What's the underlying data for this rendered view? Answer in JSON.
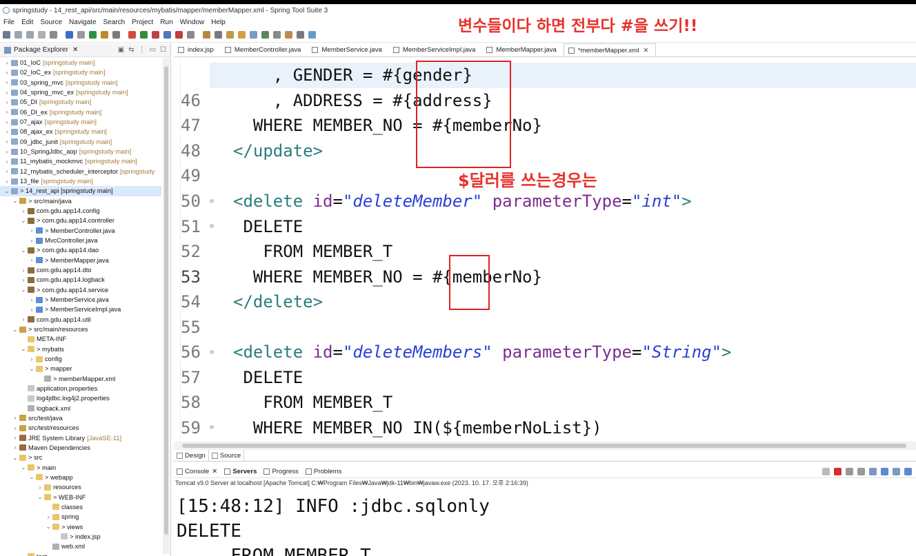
{
  "window": {
    "title": "springstudy - 14_rest_api/src/main/resources/mybatis/mapper/memberMapper.xml - Spring Tool Suite 3"
  },
  "menu": [
    "File",
    "Edit",
    "Source",
    "Navigate",
    "Search",
    "Project",
    "Run",
    "Window",
    "Help"
  ],
  "annotations": {
    "top": "변수들이다 하면 전부다 #을 쓰기!!",
    "middle": "$달러를 쓰는경우는"
  },
  "explorer": {
    "title": "Package Explorer",
    "items": [
      {
        "label": "01_IoC",
        "dec": "[springstudy main]",
        "indent": 0,
        "icon": "proj",
        "tw": "›"
      },
      {
        "label": "02_IoC_ex",
        "dec": "[springstudy main]",
        "indent": 0,
        "icon": "proj",
        "tw": "›"
      },
      {
        "label": "03_spring_mvc",
        "dec": "[springstudy main]",
        "indent": 0,
        "icon": "proj",
        "tw": "›"
      },
      {
        "label": "04_spring_mvc_ex",
        "dec": "[springstudy main]",
        "indent": 0,
        "icon": "proj",
        "tw": "›"
      },
      {
        "label": "05_DI",
        "dec": "[springstudy main]",
        "indent": 0,
        "icon": "proj",
        "tw": "›"
      },
      {
        "label": "06_DI_ex",
        "dec": "[springstudy main]",
        "indent": 0,
        "icon": "proj",
        "tw": "›"
      },
      {
        "label": "07_ajax",
        "dec": "[springstudy main]",
        "indent": 0,
        "icon": "proj",
        "tw": "›"
      },
      {
        "label": "08_ajax_ex",
        "dec": "[springstudy main]",
        "indent": 0,
        "icon": "proj",
        "tw": "›"
      },
      {
        "label": "09_jdbc_junit",
        "dec": "[springstudy main]",
        "indent": 0,
        "icon": "proj",
        "tw": "›"
      },
      {
        "label": "10_SpringJdbc_aop",
        "dec": "[springstudy main]",
        "indent": 0,
        "icon": "proj",
        "tw": "›"
      },
      {
        "label": "11_mybatis_mockmvc",
        "dec": "[springstudy main]",
        "indent": 0,
        "icon": "proj",
        "tw": "›"
      },
      {
        "label": "12_mybatis_scheduler_interceptor",
        "dec": "[springstudy",
        "indent": 0,
        "icon": "proj",
        "tw": "›"
      },
      {
        "label": "13_file",
        "dec": "[springstudy main]",
        "indent": 0,
        "icon": "proj",
        "tw": "›"
      },
      {
        "label": "> 14_rest_api [springstudy main]",
        "dec": "",
        "indent": 0,
        "icon": "proj",
        "tw": "⌄",
        "selected": true
      },
      {
        "label": "> src/main/java",
        "dec": "",
        "indent": 1,
        "icon": "srcf",
        "tw": "⌄"
      },
      {
        "label": "com.gdu.app14.config",
        "dec": "",
        "indent": 2,
        "icon": "pkg",
        "tw": "›"
      },
      {
        "label": "> com.gdu.app14.controller",
        "dec": "",
        "indent": 2,
        "icon": "pkg",
        "tw": "⌄"
      },
      {
        "label": "> MemberController.java",
        "dec": "",
        "indent": 3,
        "icon": "java",
        "tw": "›"
      },
      {
        "label": "MvcController.java",
        "dec": "",
        "indent": 3,
        "icon": "java",
        "tw": "›"
      },
      {
        "label": "> com.gdu.app14.dao",
        "dec": "",
        "indent": 2,
        "icon": "pkg",
        "tw": "⌄"
      },
      {
        "label": "> MemberMapper.java",
        "dec": "",
        "indent": 3,
        "icon": "java",
        "tw": "›"
      },
      {
        "label": "com.gdu.app14.dto",
        "dec": "",
        "indent": 2,
        "icon": "pkg",
        "tw": "›"
      },
      {
        "label": "com.gdu.app14.logback",
        "dec": "",
        "indent": 2,
        "icon": "pkg",
        "tw": "›"
      },
      {
        "label": "> com.gdu.app14.service",
        "dec": "",
        "indent": 2,
        "icon": "pkg",
        "tw": "⌄"
      },
      {
        "label": "> MemberService.java",
        "dec": "",
        "indent": 3,
        "icon": "java",
        "tw": "›"
      },
      {
        "label": "> MemberServiceImpl.java",
        "dec": "",
        "indent": 3,
        "icon": "java",
        "tw": "›"
      },
      {
        "label": "com.gdu.app14.util",
        "dec": "",
        "indent": 2,
        "icon": "pkg",
        "tw": "›"
      },
      {
        "label": "> src/main/resources",
        "dec": "",
        "indent": 1,
        "icon": "srcf",
        "tw": "⌄"
      },
      {
        "label": "META-INF",
        "dec": "",
        "indent": 2,
        "icon": "folder",
        "tw": ""
      },
      {
        "label": "> mybatis",
        "dec": "",
        "indent": 2,
        "icon": "folder",
        "tw": "⌄"
      },
      {
        "label": "config",
        "dec": "",
        "indent": 3,
        "icon": "folder",
        "tw": "›"
      },
      {
        "label": "> mapper",
        "dec": "",
        "indent": 3,
        "icon": "folder",
        "tw": "⌄"
      },
      {
        "label": "> memberMapper.xml",
        "dec": "",
        "indent": 4,
        "icon": "xml",
        "tw": ""
      },
      {
        "label": "application.properties",
        "dec": "",
        "indent": 2,
        "icon": "file",
        "tw": ""
      },
      {
        "label": "log4jdbc.log4j2.properties",
        "dec": "",
        "indent": 2,
        "icon": "file",
        "tw": ""
      },
      {
        "label": "logback.xml",
        "dec": "",
        "indent": 2,
        "icon": "xml",
        "tw": ""
      },
      {
        "label": "src/test/java",
        "dec": "",
        "indent": 1,
        "icon": "srcf",
        "tw": "›"
      },
      {
        "label": "src/test/resources",
        "dec": "",
        "indent": 1,
        "icon": "srcf",
        "tw": "›"
      },
      {
        "label": "JRE System Library",
        "dec": "[JavaSE-11]",
        "indent": 1,
        "icon": "lib",
        "tw": "›"
      },
      {
        "label": "Maven Dependencies",
        "dec": "",
        "indent": 1,
        "icon": "lib",
        "tw": "›"
      },
      {
        "label": "> src",
        "dec": "",
        "indent": 1,
        "icon": "folder",
        "tw": "⌄"
      },
      {
        "label": "> main",
        "dec": "",
        "indent": 2,
        "icon": "folder",
        "tw": "⌄"
      },
      {
        "label": "> webapp",
        "dec": "",
        "indent": 3,
        "icon": "folder",
        "tw": "⌄"
      },
      {
        "label": "resources",
        "dec": "",
        "indent": 4,
        "icon": "folder",
        "tw": "›"
      },
      {
        "label": "> WEB-INF",
        "dec": "",
        "indent": 4,
        "icon": "folder",
        "tw": "⌄"
      },
      {
        "label": "classes",
        "dec": "",
        "indent": 5,
        "icon": "folder",
        "tw": ""
      },
      {
        "label": "spring",
        "dec": "",
        "indent": 5,
        "icon": "folder",
        "tw": "›"
      },
      {
        "label": "> views",
        "dec": "",
        "indent": 5,
        "icon": "folder",
        "tw": "⌄"
      },
      {
        "label": "> index.jsp",
        "dec": "",
        "indent": 6,
        "icon": "file",
        "tw": ""
      },
      {
        "label": "web.xml",
        "dec": "",
        "indent": 5,
        "icon": "xml",
        "tw": ""
      },
      {
        "label": "test",
        "dec": "",
        "indent": 2,
        "icon": "folder",
        "tw": ""
      }
    ]
  },
  "tabs": [
    {
      "label": "index.jsp",
      "active": false
    },
    {
      "label": "MemberController.java",
      "active": false
    },
    {
      "label": "MemberService.java",
      "active": false
    },
    {
      "label": "MemberServiceImpl.java",
      "active": false
    },
    {
      "label": "MemberMapper.java",
      "active": false
    },
    {
      "label": "*memberMapper.xml",
      "active": true
    }
  ],
  "code_lines": [
    {
      "num": "45",
      "fold": false,
      "hl": true,
      "parts": [
        [
          "plain",
          "    , GENDER = #{gender}"
        ]
      ]
    },
    {
      "num": "46",
      "fold": false,
      "parts": [
        [
          "plain",
          "    , ADDRESS = #{address}"
        ]
      ]
    },
    {
      "num": "47",
      "fold": false,
      "parts": [
        [
          "plain",
          "  WHERE MEMBER_NO = #{memberNo}"
        ]
      ]
    },
    {
      "num": "48",
      "fold": false,
      "parts": [
        [
          "tag",
          "</update>"
        ]
      ]
    },
    {
      "num": "49",
      "fold": false,
      "parts": [
        [
          "plain",
          ""
        ]
      ]
    },
    {
      "num": "50",
      "fold": true,
      "parts": [
        [
          "tag",
          "<delete "
        ],
        [
          "attr",
          "id"
        ],
        [
          "plain",
          "="
        ],
        [
          "str",
          "\"deleteMember\""
        ],
        [
          "plain",
          " "
        ],
        [
          "attr",
          "parameterType"
        ],
        [
          "plain",
          "="
        ],
        [
          "str",
          "\"int\""
        ],
        [
          "tag",
          ">"
        ]
      ]
    },
    {
      "num": "51",
      "fold": true,
      "parts": [
        [
          "plain",
          " DELETE"
        ]
      ]
    },
    {
      "num": "52",
      "fold": false,
      "parts": [
        [
          "plain",
          "   FROM MEMBER_T"
        ]
      ]
    },
    {
      "num": "53",
      "fold": false,
      "cur": true,
      "parts": [
        [
          "plain",
          "  WHERE MEMBER_NO = #{memberNo}"
        ]
      ]
    },
    {
      "num": "54",
      "fold": false,
      "parts": [
        [
          "tag",
          "</delete>"
        ]
      ]
    },
    {
      "num": "55",
      "fold": false,
      "parts": [
        [
          "plain",
          ""
        ]
      ]
    },
    {
      "num": "56",
      "fold": true,
      "parts": [
        [
          "tag",
          "<delete "
        ],
        [
          "attr",
          "id"
        ],
        [
          "plain",
          "="
        ],
        [
          "str",
          "\"deleteMembers\""
        ],
        [
          "plain",
          " "
        ],
        [
          "attr",
          "parameterType"
        ],
        [
          "plain",
          "="
        ],
        [
          "str",
          "\"String\""
        ],
        [
          "tag",
          ">"
        ]
      ]
    },
    {
      "num": "57",
      "fold": false,
      "parts": [
        [
          "plain",
          " DELETE"
        ]
      ]
    },
    {
      "num": "58",
      "fold": false,
      "parts": [
        [
          "plain",
          "   FROM MEMBER_T"
        ]
      ]
    },
    {
      "num": "59",
      "fold": true,
      "parts": [
        [
          "plain",
          "  WHERE MEMBER_NO IN(${memberNoList})"
        ]
      ]
    }
  ],
  "editor_bottom_tabs": [
    {
      "label": "Design",
      "active": false
    },
    {
      "label": "Source",
      "active": true
    }
  ],
  "console": {
    "tabs": [
      {
        "label": "Console",
        "closable": true,
        "bold": false
      },
      {
        "label": "Servers",
        "closable": false,
        "bold": true
      },
      {
        "label": "Progress",
        "closable": false,
        "bold": false
      },
      {
        "label": "Problems",
        "closable": false,
        "bold": false
      }
    ],
    "info": "Tomcat v9.0 Server at localhost [Apache Tomcat] C:₩Program Files₩Java₩jdk-11₩bin₩javaw.exe  (2023. 10. 17. 오후 2:16:39)",
    "lines": [
      "[15:48:12] INFO :jdbc.sqlonly",
      "DELETE",
      "     FROM MEMBER_T"
    ]
  }
}
